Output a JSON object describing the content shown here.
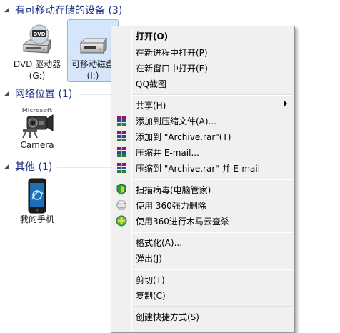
{
  "groups": {
    "removable": {
      "title": "有可移动存储的设备 (3)"
    },
    "network": {
      "title": "网络位置 (1)"
    },
    "other": {
      "title": "其他 (1)"
    }
  },
  "items": {
    "dvd": {
      "label": "DVD 驱动器 (G:)",
      "icon": "dvd-drive-icon"
    },
    "removable": {
      "label": "可移动磁盘 (I:)",
      "icon": "removable-disk-icon"
    },
    "camera": {
      "label": "Camera",
      "icon": "webcam-icon"
    },
    "phone": {
      "label": "我的手机",
      "icon": "smartphone-icon"
    }
  },
  "menu": {
    "open": "打开(O)",
    "open_new_process": "在新进程中打开(P)",
    "open_new_window": "在新窗口中打开(E)",
    "qq_screenshot": "QQ截图",
    "share": "共享(H)",
    "add_to_archive": "添加到压缩文件(A)...",
    "add_to_archive_rar": "添加到 \"Archive.rar\"(T)",
    "compress_email": "压缩并 E-mail...",
    "compress_rar_email": "压缩到 \"Archive.rar\" 并 E-mail",
    "scan_virus": "扫描病毒(电脑管家)",
    "force_delete": "使用 360强力删除",
    "trojan_scan": "使用360进行木马云查杀",
    "format": "格式化(A)...",
    "eject": "弹出(J)",
    "cut": "剪切(T)",
    "copy": "复制(C)",
    "create_shortcut": "创建快捷方式(S)"
  },
  "colors": {
    "group_header": "#1e3287",
    "selection_bg": "#d5e6fb",
    "menu_bg": "#f0f0f0"
  }
}
